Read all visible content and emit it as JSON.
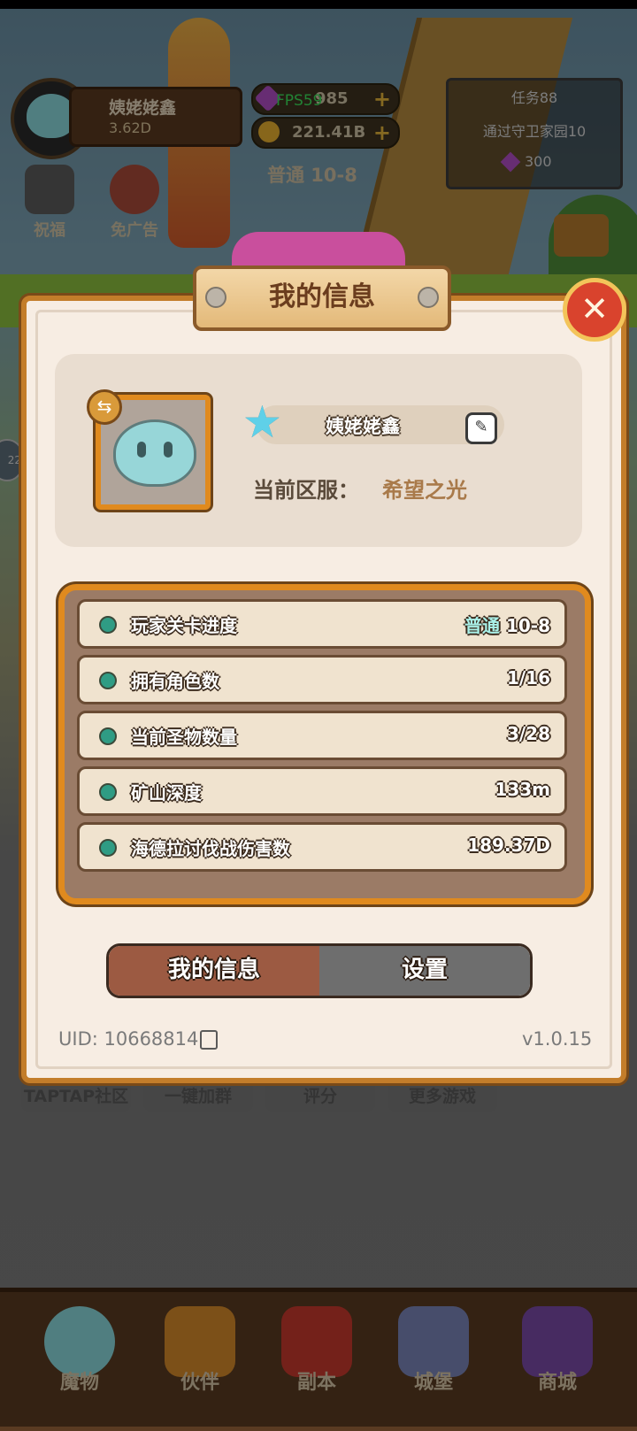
{
  "hud": {
    "player_name": "姨姥姥鑫",
    "power": "3.62D",
    "gems": "985",
    "fps": "FPS59",
    "gold": "221.41B",
    "stage": "普通 10-8",
    "task": {
      "title": "任务88",
      "desc": "通过守卫家园10",
      "reward": "300"
    },
    "side_bless": "祝福",
    "side_noad": "免广告",
    "left_badge": "22"
  },
  "links": [
    "TAPTAP社区",
    "一键加群",
    "评分",
    "更多游戏"
  ],
  "nav": [
    "魔物",
    "伙伴",
    "副本",
    "城堡",
    "商城"
  ],
  "dialog": {
    "title": "我的信息",
    "close_symbol": "✕",
    "name": "姨姥姥鑫",
    "server_label": "当前区服：",
    "server_value": "希望之光",
    "stats": [
      {
        "label": "玩家关卡进度",
        "mode": "普通",
        "value": "10-8"
      },
      {
        "label": "拥有角色数",
        "mode": "",
        "value": "1/16"
      },
      {
        "label": "当前圣物数量",
        "mode": "",
        "value": "3/28"
      },
      {
        "label": "矿山深度",
        "mode": "",
        "value": "133m"
      },
      {
        "label": "海德拉讨伐战伤害数",
        "mode": "",
        "value": "189.37D"
      }
    ],
    "tabs": {
      "active": "我的信息",
      "inactive": "设置"
    },
    "uid": "UID: 10668814",
    "version": "v1.0.15"
  },
  "colors": {
    "accent_orange": "#e08a1e",
    "close_red": "#d9432d",
    "active_tab": "#9c5a42",
    "inactive_tab": "#6e6e6e",
    "star": "#5fd0e8"
  },
  "icons": [
    "gem-icon",
    "coin-icon",
    "star-icon",
    "edit-icon",
    "copy-icon",
    "swap-icon",
    "close-icon"
  ]
}
